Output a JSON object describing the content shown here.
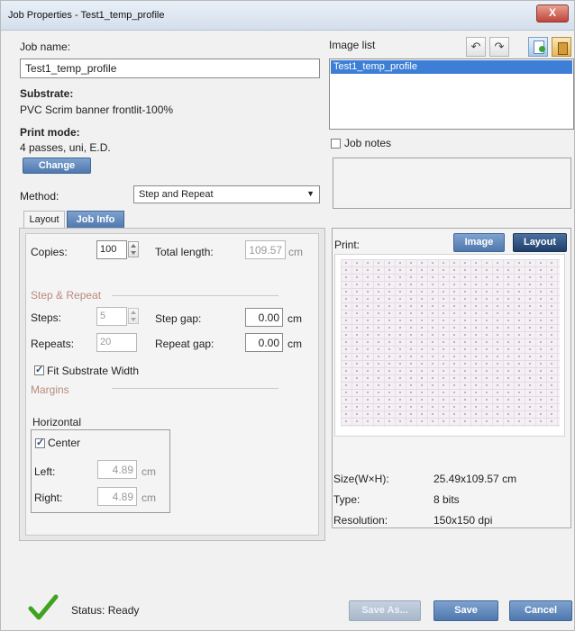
{
  "window": {
    "title": "Job Properties - Test1_temp_profile",
    "close_label": "X"
  },
  "job": {
    "name_label": "Job name:",
    "name_value": "Test1_temp_profile",
    "substrate_label": "Substrate:",
    "substrate_value": "PVC Scrim banner frontlit-100%",
    "print_mode_label": "Print mode:",
    "print_mode_value": "4 passes, uni, E.D.",
    "change_label": "Change",
    "method_label": "Method:",
    "method_value": "Step and Repeat"
  },
  "tabs": [
    {
      "label": "Layout"
    },
    {
      "label": "Job Info"
    }
  ],
  "layout": {
    "copies_label": "Copies:",
    "copies_value": "100",
    "total_length_label": "Total length:",
    "total_length_value": "109.57",
    "total_length_unit": "cm",
    "step_repeat_title": "Step & Repeat",
    "steps_label": "Steps:",
    "steps_value": "5",
    "step_gap_label": "Step gap:",
    "step_gap_value": "0.00",
    "step_gap_unit": "cm",
    "repeats_label": "Repeats:",
    "repeats_value": "20",
    "repeat_gap_label": "Repeat gap:",
    "repeat_gap_value": "0.00",
    "repeat_gap_unit": "cm",
    "fit_substrate_label": "Fit Substrate Width",
    "margins_title": "Margins",
    "horizontal_label": "Horizontal",
    "center_label": "Center",
    "left_label": "Left:",
    "left_value": "4.89",
    "left_unit": "cm",
    "right_label": "Right:",
    "right_value": "4.89",
    "right_unit": "cm"
  },
  "image_list": {
    "label": "Image list",
    "items": [
      "Test1_temp_profile"
    ],
    "job_notes_label": "Job notes"
  },
  "preview": {
    "print_label": "Print:",
    "image_button": "Image",
    "layout_button": "Layout",
    "size_label": "Size(W×H):",
    "size_value": "25.49x109.57 cm",
    "type_label": "Type:",
    "type_value": "8 bits",
    "resolution_label": "Resolution:",
    "resolution_value": "150x150 dpi"
  },
  "status": {
    "label": "Status: Ready"
  },
  "footer": {
    "save_as": "Save As...",
    "save": "Save",
    "cancel": "Cancel"
  },
  "colors": {
    "accent": "#4f78ad",
    "section": "#b98a7c",
    "selection": "#3d7fd6",
    "status_ok": "#3ea31f"
  }
}
